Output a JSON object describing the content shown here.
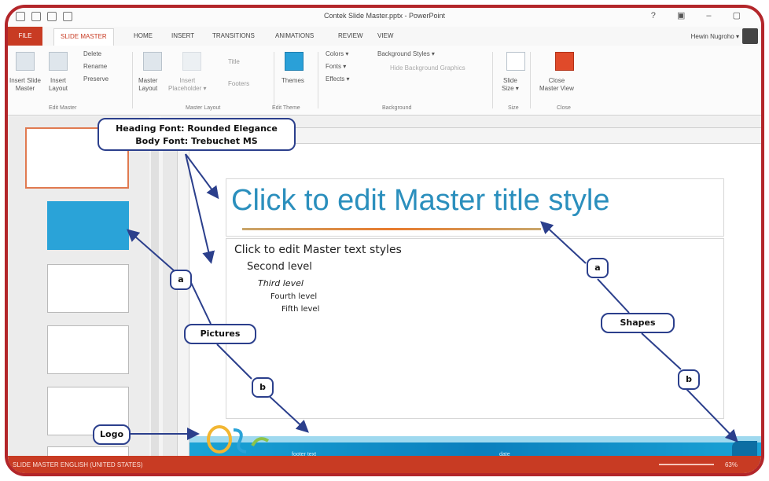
{
  "window": {
    "title": "Contek Slide Master.pptx - PowerPoint",
    "controls": "? ▣ – ▢"
  },
  "tabs": {
    "file": "FILE",
    "items": [
      "SLIDE MASTER",
      "HOME",
      "INSERT",
      "TRANSITIONS",
      "ANIMATIONS",
      "REVIEW",
      "VIEW"
    ],
    "user": "Hewin Nugroho ▾"
  },
  "ribbon": {
    "insert_slide_master": "Insert Slide\nMaster",
    "insert_layout": "Insert\nLayout",
    "delete": "Delete",
    "rename": "Rename",
    "preserve": "Preserve",
    "master_layout": "Master\nLayout",
    "insert_placeholder": "Insert\nPlaceholder ▾",
    "title": "Title",
    "footers": "Footers",
    "themes": "Themes",
    "colors": "Colors ▾",
    "fonts": "Fonts ▾",
    "effects": "Effects ▾",
    "background_styles": "Background Styles ▾",
    "hide_background": "Hide Background Graphics",
    "slide_size": "Slide\nSize ▾",
    "close_master": "Close\nMaster View",
    "groups": [
      "Edit Master",
      "Master Layout",
      "Edit Theme",
      "Background",
      "Size",
      "Close"
    ]
  },
  "slide": {
    "title_text": "Click to edit Master title style",
    "levels": [
      "Click to edit Master text styles",
      "Second level",
      "Third level",
      "Fourth level",
      "Fifth level"
    ],
    "footer_left": "footer text",
    "footer_right": "date"
  },
  "callouts": {
    "fonts": "Heading Font: Rounded Elegance\nBody Font: Trebuchet MS",
    "pictures": "Pictures",
    "shapes": "Shapes",
    "logo": "Logo",
    "a_left": "a",
    "a_right": "a",
    "b_left": "b",
    "b_right": "b"
  },
  "status": {
    "left": "SLIDE MASTER   ENGLISH (UNITED STATES)",
    "zoom": "63%"
  },
  "colors": {
    "accent": "#c83b23",
    "banner": "#1aa3d6",
    "callout_border": "#2b3f8c",
    "title_text": "#2b8fbd"
  }
}
